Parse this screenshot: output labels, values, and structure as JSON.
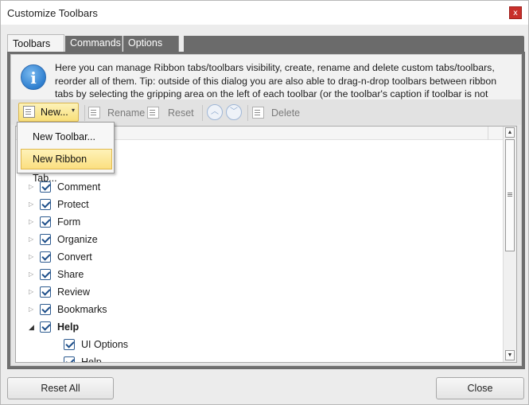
{
  "window": {
    "title": "Customize Toolbars",
    "close_glyph": "x"
  },
  "tabs": [
    {
      "label": "Toolbars",
      "active": true
    },
    {
      "label": "Commands",
      "active": false
    },
    {
      "label": "Options",
      "active": false
    }
  ],
  "info": {
    "icon": "info-icon",
    "glyph": "i",
    "text": "Here you can manage Ribbon tabs/toolbars visibility, create, rename and delete custom tabs/toolbars, reorder all of them. Tip: outside of this dialog you are also able to drag-n-drop toolbars between ribbon tabs by selecting the gripping area on the left of each toolbar (or the toolbar's caption if toolbar is not docked)."
  },
  "toolbar": {
    "new_label": "New...",
    "caret": "▾",
    "rename_label": "Rename",
    "reset_label": "Reset",
    "up_glyph": "︿",
    "down_glyph": "﹀",
    "delete_label": "Delete"
  },
  "dropdown": {
    "items": [
      {
        "label": "New Toolbar...",
        "hover": false
      },
      {
        "label": "New Ribbon Tab...",
        "hover": true
      }
    ]
  },
  "tree": {
    "items": [
      {
        "label": "Comment",
        "expander": "▷",
        "checked": true
      },
      {
        "label": "Protect",
        "expander": "▷",
        "checked": true
      },
      {
        "label": "Form",
        "expander": "▷",
        "checked": true
      },
      {
        "label": "Organize",
        "expander": "▷",
        "checked": true
      },
      {
        "label": "Convert",
        "expander": "▷",
        "checked": true
      },
      {
        "label": "Share",
        "expander": "▷",
        "checked": true
      },
      {
        "label": "Review",
        "expander": "▷",
        "checked": true
      },
      {
        "label": "Bookmarks",
        "expander": "▷",
        "checked": true
      },
      {
        "label": "Help",
        "expander": "◢",
        "checked": true,
        "bold": true
      },
      {
        "label": "UI Options",
        "expander": "",
        "checked": true,
        "child": true
      },
      {
        "label": "Help",
        "expander": "",
        "checked": true,
        "child": true
      }
    ],
    "scroll_up": "▲",
    "scroll_down": "▼"
  },
  "footer": {
    "reset_all_label": "Reset All",
    "close_label": "Close"
  },
  "colors": {
    "accent_yellow": "#f8df7a",
    "check_blue": "#1e4f8a",
    "close_red": "#c8302b"
  }
}
